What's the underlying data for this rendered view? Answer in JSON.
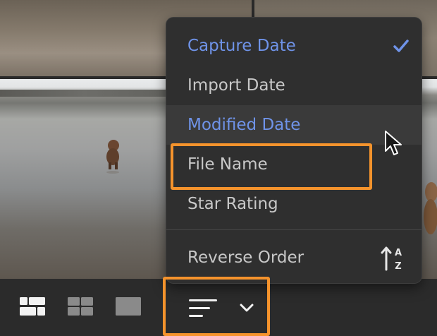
{
  "colors": {
    "accent_selected": "#6f93e8",
    "menu_text": "#c8c8c8",
    "highlight_orange": "#f5932c",
    "menu_background": "#2f2f2f"
  },
  "sort_menu": {
    "items": [
      {
        "label": "Capture Date",
        "selected": true,
        "checked": true
      },
      {
        "label": "Import Date",
        "selected": false
      },
      {
        "label": "Modified Date",
        "selected": true,
        "hovered": true
      },
      {
        "label": "File Name",
        "selected": false,
        "highlighted": true
      },
      {
        "label": "Star Rating",
        "selected": false
      }
    ],
    "reverse_order": {
      "label": "Reverse Order",
      "icon": "sort-az-icon"
    },
    "check_icon": "checkmark-icon"
  },
  "toolbar": {
    "view_buttons": [
      {
        "icon": "square-grid-large-icon"
      },
      {
        "icon": "square-grid-icon"
      },
      {
        "icon": "single-view-icon"
      }
    ],
    "sort_button": {
      "icon": "sort-lines-icon",
      "dropdown_icon": "chevron-down-icon"
    }
  }
}
